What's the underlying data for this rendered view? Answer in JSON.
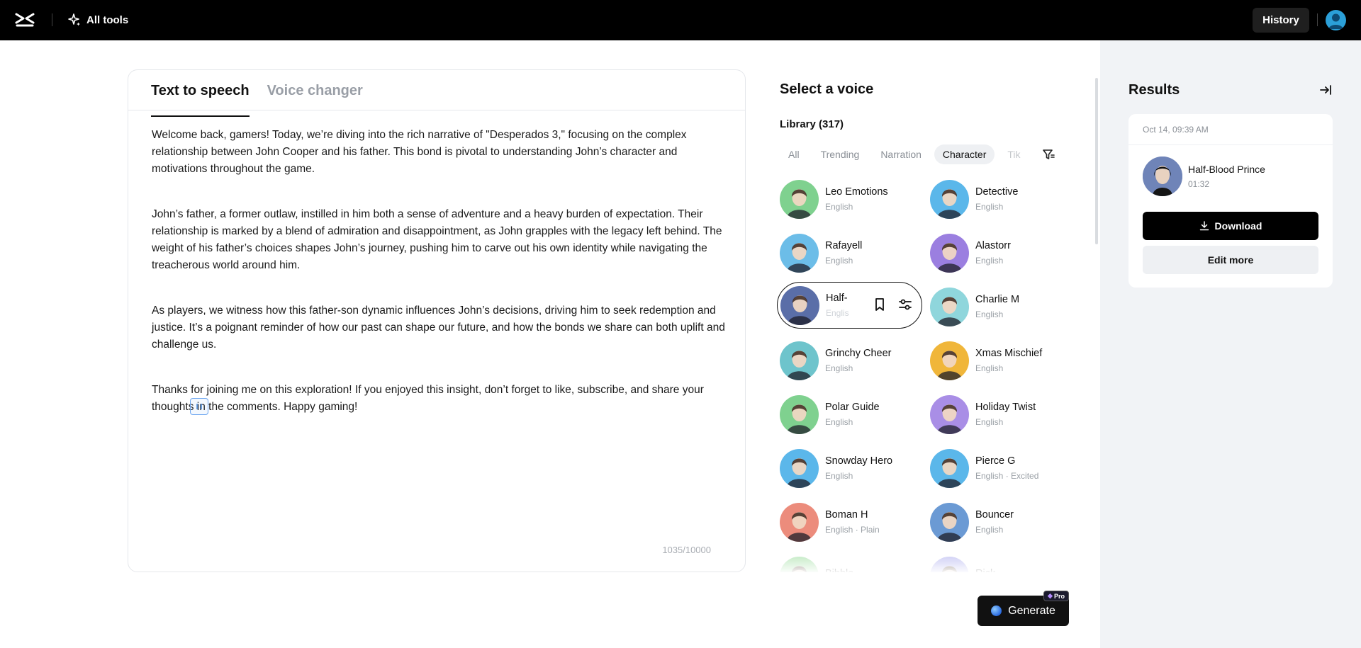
{
  "topbar": {
    "all_tools_label": "All tools",
    "history_label": "History"
  },
  "editor": {
    "tabs": [
      {
        "label": "Text to speech",
        "active": true
      },
      {
        "label": "Voice changer",
        "active": false
      }
    ],
    "paragraphs": [
      "Welcome back, gamers! Today, we’re diving into the rich narrative of \"Desperados 3,\" focusing on the complex relationship between John Cooper and his father. This bond is pivotal to understanding John’s character and motivations throughout the game.",
      "John’s father, a former outlaw, instilled in him both a sense of adventure and a heavy burden of expectation. Their relationship is marked by a blend of admiration and disappointment, as John grapples with the legacy left behind. The weight of his father’s choices shapes John’s journey, pushing him to carve out his own identity while navigating the treacherous world around him.",
      "As players, we witness how this father-son dynamic influences John’s decisions, driving him to seek redemption and justice. It’s a poignant reminder of how our past can shape our future, and how the bonds we share can both uplift and challenge us.",
      "Thanks for joining me on this exploration! If you enjoyed this insight, don’t forget to like, subscribe, and share your thoughts in the comments. Happy gaming!"
    ],
    "char_count": "1035/10000"
  },
  "voices": {
    "title": "Select a voice",
    "library_label": "Library (317)",
    "filters": [
      {
        "label": "All",
        "active": false
      },
      {
        "label": "Trending",
        "active": false
      },
      {
        "label": "Narration",
        "active": false
      },
      {
        "label": "Character",
        "active": true
      },
      {
        "label": "Tik",
        "active": false
      }
    ],
    "items": [
      {
        "name": "Leo Emotions",
        "sub": "English",
        "color": "#7fd18f"
      },
      {
        "name": "Detective",
        "sub": "English",
        "color": "#5bb7ea"
      },
      {
        "name": "Rafayell",
        "sub": "English",
        "color": "#6cbde8"
      },
      {
        "name": "Alastorr",
        "sub": "English",
        "color": "#9b7fe0"
      },
      {
        "name": "Half-",
        "sub": "Englis",
        "color": "#5a6ea8",
        "selected": true
      },
      {
        "name": "Charlie M",
        "sub": "English",
        "color": "#8fd6dc"
      },
      {
        "name": "Grinchy Cheer",
        "sub": "English",
        "color": "#6ec4cc"
      },
      {
        "name": "Xmas Mischief",
        "sub": "English",
        "color": "#f0b63a"
      },
      {
        "name": "Polar Guide",
        "sub": "English",
        "color": "#7fd18f"
      },
      {
        "name": "Holiday Twist",
        "sub": "English",
        "color": "#a98ee6"
      },
      {
        "name": "Snowday Hero",
        "sub": "English",
        "color": "#5bb7ea"
      },
      {
        "name": "Pierce G",
        "sub": "English · Excited",
        "color": "#5bb7ea"
      },
      {
        "name": "Boman H",
        "sub": "English · Plain",
        "color": "#ec8c7c"
      },
      {
        "name": "Bouncer",
        "sub": "English",
        "color": "#6b9ad4"
      },
      {
        "name": "Bibble",
        "sub": "",
        "color": "#a6e0a8"
      },
      {
        "name": "Rick",
        "sub": "",
        "color": "#b6b6f0"
      }
    ]
  },
  "generate": {
    "label": "Generate",
    "badge": "Pro"
  },
  "results": {
    "title": "Results",
    "date": "Oct 14, 09:39 AM",
    "voice_name": "Half-Blood Prince",
    "duration": "01:32",
    "download_label": "Download",
    "edit_more_label": "Edit more"
  }
}
